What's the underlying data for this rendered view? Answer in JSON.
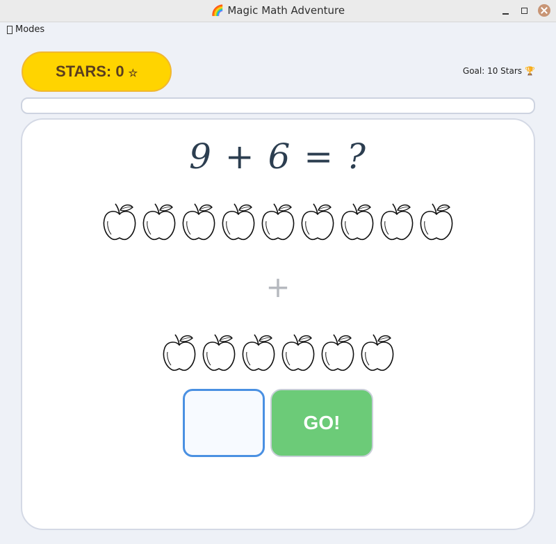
{
  "window": {
    "title": "🌈 Magic Math Adventure"
  },
  "menu": {
    "modes_label": "Modes"
  },
  "score": {
    "stars_label": "STARS: 0",
    "star_glyph": "☆",
    "goal_label": "Goal: 10 Stars",
    "goal_icon": "🏆"
  },
  "progress": {
    "value": 0
  },
  "problem": {
    "equation": "9 + 6 = ?",
    "operator": "+",
    "first_count": 9,
    "second_count": 6,
    "item_icon": "apple-icon"
  },
  "answer": {
    "value": ""
  },
  "go_button": {
    "label": "GO!"
  },
  "colors": {
    "accent": "#ffd400",
    "go": "#6ccb78",
    "input_border": "#4a90e2",
    "equation": "#2c3e50"
  }
}
